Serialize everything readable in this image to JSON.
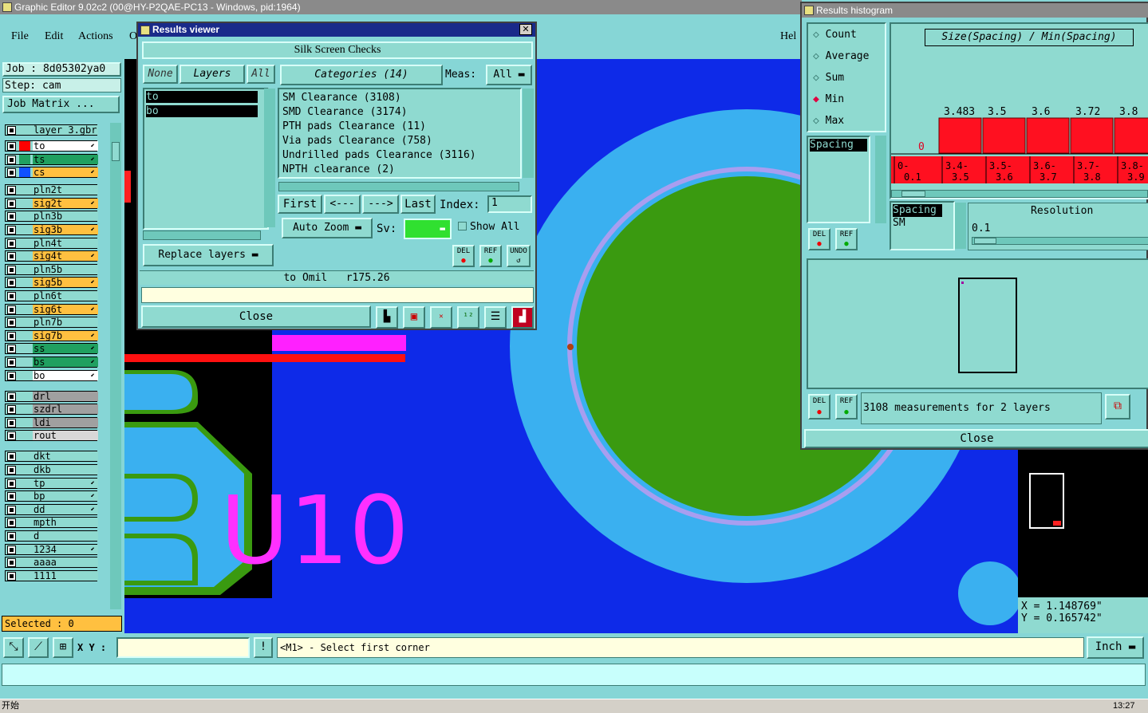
{
  "app": {
    "title": "Graphic Editor 9.02c2 (00@HY-P2QAE-PC13 - Windows, pid:1964)"
  },
  "menu": {
    "file": "File",
    "edit": "Edit",
    "actions": "Actions",
    "o": "O",
    "help": "Hel"
  },
  "job": {
    "job_label": "Job : 8d05302ya0",
    "step_label": "Step: cam",
    "matrix_button": "Job Matrix ..."
  },
  "layers": [
    {
      "name": "layer_3.gbr",
      "color": "#8fdad0",
      "dot": "",
      "arrow": ""
    },
    {
      "name": "to",
      "color": "#ffffff",
      "dot": "#ff0000",
      "arrow": "⬋"
    },
    {
      "name": "ts",
      "color": "#20a060",
      "dot": "#20a060",
      "arrow": "⬋"
    },
    {
      "name": "cs",
      "color": "#ffc040",
      "dot": "#1050ff",
      "arrow": "⬋"
    },
    {
      "name": "pln2t",
      "color": "#8fdad0",
      "dot": "",
      "arrow": ""
    },
    {
      "name": "sig2t",
      "color": "#ffc040",
      "dot": "",
      "arrow": "⬋"
    },
    {
      "name": "pln3b",
      "color": "#8fdad0",
      "dot": "",
      "arrow": ""
    },
    {
      "name": "sig3b",
      "color": "#ffc040",
      "dot": "",
      "arrow": "⬋"
    },
    {
      "name": "pln4t",
      "color": "#8fdad0",
      "dot": "",
      "arrow": ""
    },
    {
      "name": "sig4t",
      "color": "#ffc040",
      "dot": "",
      "arrow": "⬋"
    },
    {
      "name": "pln5b",
      "color": "#8fdad0",
      "dot": "",
      "arrow": ""
    },
    {
      "name": "sig5b",
      "color": "#ffc040",
      "dot": "",
      "arrow": "⬋"
    },
    {
      "name": "pln6t",
      "color": "#8fdad0",
      "dot": "",
      "arrow": ""
    },
    {
      "name": "sig6t",
      "color": "#ffc040",
      "dot": "",
      "arrow": "⬋"
    },
    {
      "name": "pln7b",
      "color": "#8fdad0",
      "dot": "",
      "arrow": ""
    },
    {
      "name": "sig7b",
      "color": "#ffc040",
      "dot": "",
      "arrow": "⬋"
    },
    {
      "name": "ss",
      "color": "#20a060",
      "dot": "",
      "arrow": "⬋"
    },
    {
      "name": "bs",
      "color": "#20a060",
      "dot": "",
      "arrow": "⬋"
    },
    {
      "name": "bo",
      "color": "#ffffff",
      "dot": "",
      "arrow": "⬋"
    },
    {
      "name": "drl",
      "color": "#a0a0a0",
      "dot": "",
      "arrow": ""
    },
    {
      "name": "szdrl",
      "color": "#a0a0a0",
      "dot": "",
      "arrow": ""
    },
    {
      "name": "ldi",
      "color": "#a0a0a0",
      "dot": "",
      "arrow": ""
    },
    {
      "name": "rout",
      "color": "#d8d8d8",
      "dot": "",
      "arrow": ""
    },
    {
      "name": "dkt",
      "color": "#8fdad0",
      "dot": "",
      "arrow": ""
    },
    {
      "name": "dkb",
      "color": "#8fdad0",
      "dot": "",
      "arrow": ""
    },
    {
      "name": "tp",
      "color": "#8fdad0",
      "dot": "",
      "arrow": "⬋"
    },
    {
      "name": "bp",
      "color": "#8fdad0",
      "dot": "",
      "arrow": "⬋"
    },
    {
      "name": "dd",
      "color": "#8fdad0",
      "dot": "",
      "arrow": "⬋"
    },
    {
      "name": "mpth",
      "color": "#8fdad0",
      "dot": "",
      "arrow": ""
    },
    {
      "name": "d",
      "color": "#8fdad0",
      "dot": "",
      "arrow": ""
    },
    {
      "name": "1234",
      "color": "#8fdad0",
      "dot": "",
      "arrow": "⬋"
    },
    {
      "name": "aaaa",
      "color": "#8fdad0",
      "dot": "",
      "arrow": ""
    },
    {
      "name": "1111",
      "color": "#8fdad0",
      "dot": "",
      "arrow": ""
    }
  ],
  "selected": "Selected : 0",
  "canvas": {
    "text": "U10"
  },
  "results_viewer": {
    "title": "Results viewer",
    "header": "Silk Screen Checks",
    "none": "None",
    "layers_tab": "Layers",
    "all": "All",
    "layer_items": [
      "to",
      "bo"
    ],
    "categories_tab": "Categories (14)",
    "meas_label": "Meas:",
    "meas_value": "All",
    "categories": [
      "SM Clearance (3108)",
      "SMD Clearance (3174)",
      "PTH pads Clearance (11)",
      "Via pads Clearance (758)",
      "Undrilled pads Clearance (3116)",
      "NPTH clearance (2)"
    ],
    "first": "First",
    "prev": "<---",
    "next": "--->",
    "last": "Last",
    "index_label": "Index:",
    "index_value": "1",
    "auto_zoom": "Auto Zoom",
    "sv_label": "Sv:",
    "show_all": "Show All",
    "replace_layers": "Replace layers",
    "del": "DEL",
    "ref": "REF",
    "undo": "UNDO",
    "status": "to Omil   r175.26",
    "close": "Close"
  },
  "histogram": {
    "title": "Results histogram",
    "options": [
      "Count",
      "Average",
      "Sum",
      "Min",
      "Max"
    ],
    "selected_option": "Min",
    "chart_title": "Size(Spacing) / Min(Spacing)",
    "zero": "0",
    "top_labels": [
      "3.483",
      "3.5",
      "3.6",
      "3.72",
      "3.8"
    ],
    "bins": [
      "0-\n0.1",
      "3.4-\n3.5",
      "3.5-\n3.6",
      "3.6-\n3.7",
      "3.7-\n3.8",
      "3.8-\n3.9"
    ],
    "list_label": "Spacing",
    "spacing_items": [
      "Spacing",
      "SM"
    ],
    "resolution_label": "Resolution",
    "resolution_value": "0.1",
    "del": "DEL",
    "ref": "REF",
    "measurements": "3108 measurements for 2 layers",
    "close": "Close"
  },
  "coords": {
    "x": "X = 1.148769\"",
    "y": "Y = 0.165742\""
  },
  "command": {
    "xy_label": "X Y :",
    "prompt": "<M1> - Select first corner",
    "unit": "Inch"
  },
  "taskbar": {
    "start": "开始",
    "time": "13:27"
  }
}
